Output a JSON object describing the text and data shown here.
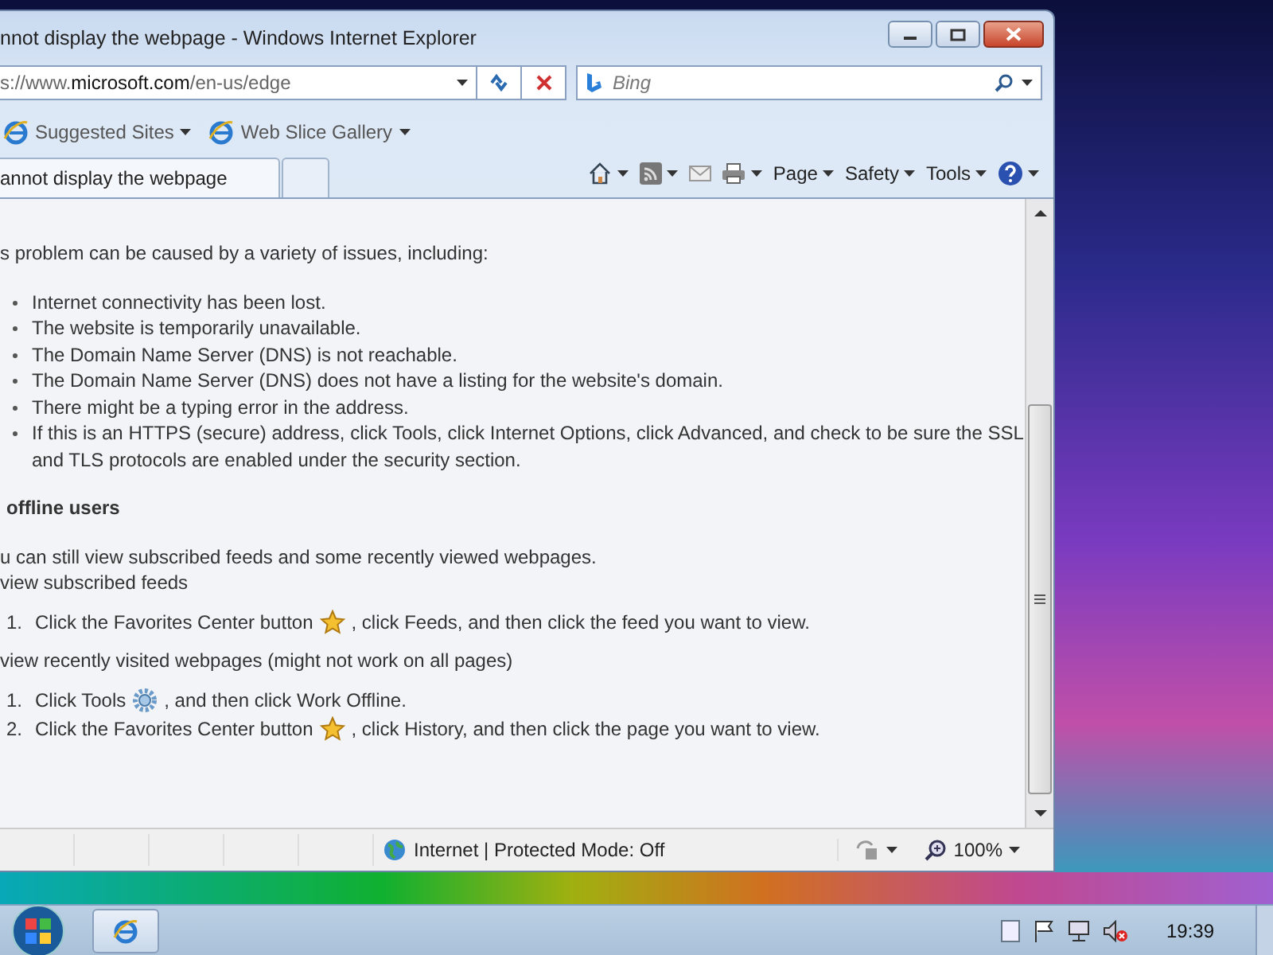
{
  "window": {
    "title": "nnot display the webpage - Windows Internet Explorer"
  },
  "address_bar": {
    "url": "s://www.**microsoft.com**/en-us/edge"
  },
  "search": {
    "placeholder": "Bing"
  },
  "favorites_bar": [
    {
      "label": "Suggested Sites"
    },
    {
      "label": "Web Slice Gallery"
    }
  ],
  "tabs": [
    {
      "label": "annot display the webpage",
      "selected": true
    }
  ],
  "command_bar": {
    "menus": [
      "Page",
      "Safety",
      "Tools"
    ]
  },
  "content": {
    "intro": "s problem can be caused by a variety of issues, including:",
    "causes": [
      "Internet connectivity has been lost.",
      "The website is temporarily unavailable.",
      "The Domain Name Server (DNS) is not reachable.",
      "The Domain Name Server (DNS) does not have a listing for the website's domain.",
      "There might be a typing error in the address.",
      "If this is an HTTPS (secure) address, click Tools, click Internet Options, click Advanced, and check to be sure the SSL and TLS protocols are enabled under the security section."
    ],
    "heading": "offline users",
    "offline_intro": "u can still view subscribed feeds and some recently viewed webpages.",
    "sections": [
      {
        "title": "view subscribed feeds",
        "steps": [
          {
            "number": "1.",
            "before": "Click the Favorites Center button",
            "kind": "star",
            "after": ", click Feeds, and then click the feed you want to view."
          }
        ]
      },
      {
        "title": "view recently visited webpages (might not work on all pages)",
        "steps": [
          {
            "number": "1.",
            "before": "Click Tools",
            "kind": "gear",
            "after": ", and then click Work Offline."
          },
          {
            "number": "2.",
            "before": "Click the Favorites Center button",
            "kind": "star",
            "after": ", click History, and then click the page you want to view."
          }
        ]
      }
    ]
  },
  "status_bar": {
    "zone": "Internet | Protected Mode: Off",
    "zoom": "100%"
  },
  "taskbar": {
    "clock": "19:39"
  }
}
